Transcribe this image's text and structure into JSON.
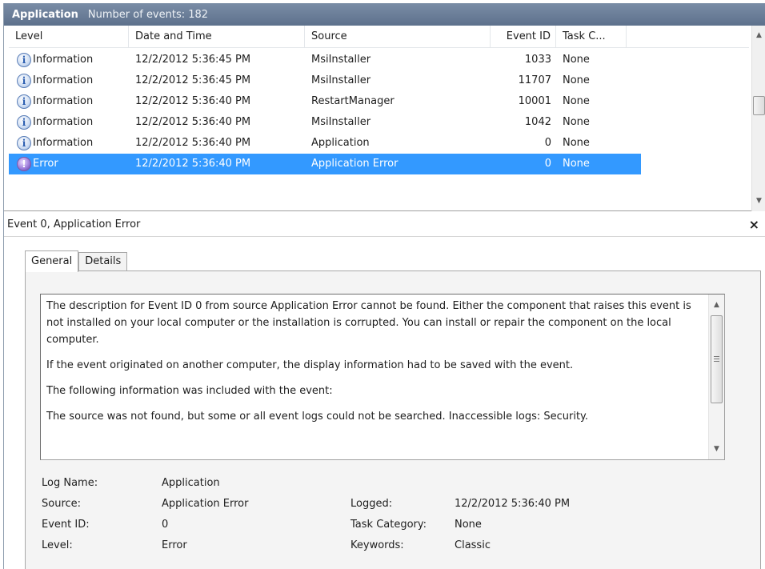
{
  "titlebar": {
    "log_name": "Application",
    "event_count": "Number of events: 182"
  },
  "columns": {
    "level": "Level",
    "date": "Date and Time",
    "source": "Source",
    "event_id": "Event ID",
    "task": "Task C..."
  },
  "events": [
    {
      "level": "Information",
      "date": "12/2/2012 5:36:45 PM",
      "source": "MsiInstaller",
      "event_id": "1033",
      "task": "None"
    },
    {
      "level": "Information",
      "date": "12/2/2012 5:36:45 PM",
      "source": "MsiInstaller",
      "event_id": "11707",
      "task": "None"
    },
    {
      "level": "Information",
      "date": "12/2/2012 5:36:40 PM",
      "source": "RestartManager",
      "event_id": "10001",
      "task": "None"
    },
    {
      "level": "Information",
      "date": "12/2/2012 5:36:40 PM",
      "source": "MsiInstaller",
      "event_id": "1042",
      "task": "None"
    },
    {
      "level": "Information",
      "date": "12/2/2012 5:36:40 PM",
      "source": "Application",
      "event_id": "0",
      "task": "None"
    },
    {
      "level": "Error",
      "date": "12/2/2012 5:36:40 PM",
      "source": "Application Error",
      "event_id": "0",
      "task": "None",
      "selected": true
    }
  ],
  "icons": {
    "info": "information-icon",
    "error": "error-icon",
    "info_glyph": "i",
    "error_glyph": "!",
    "close_glyph": "×",
    "scroll_up_glyph": "▲",
    "scroll_down_glyph": "▼"
  },
  "details": {
    "title": "Event 0, Application Error",
    "tabs": [
      "General",
      "Details"
    ],
    "description": [
      "The description for Event ID 0 from source Application Error cannot be found. Either the component that raises this event is not installed on your local computer or the installation is corrupted. You can install or repair the component on the local computer.",
      "If the event originated on another computer, the display information had to be saved with the event.",
      "The following information was included with the event:",
      "The source was not found, but some or all event logs could not be searched.  Inaccessible logs: Security."
    ],
    "properties": {
      "log_name_label": "Log Name:",
      "log_name_value": "Application",
      "source_label": "Source:",
      "source_value": "Application Error",
      "logged_label": "Logged:",
      "logged_value": "12/2/2012 5:36:40 PM",
      "event_id_label": "Event ID:",
      "event_id_value": "0",
      "task_category_label": "Task Category:",
      "task_category_value": "None",
      "level_label": "Level:",
      "level_value": "Error",
      "keywords_label": "Keywords:",
      "keywords_value": "Classic"
    }
  },
  "colors": {
    "selection": "#3399ff",
    "titlebar": "#5d718c"
  }
}
